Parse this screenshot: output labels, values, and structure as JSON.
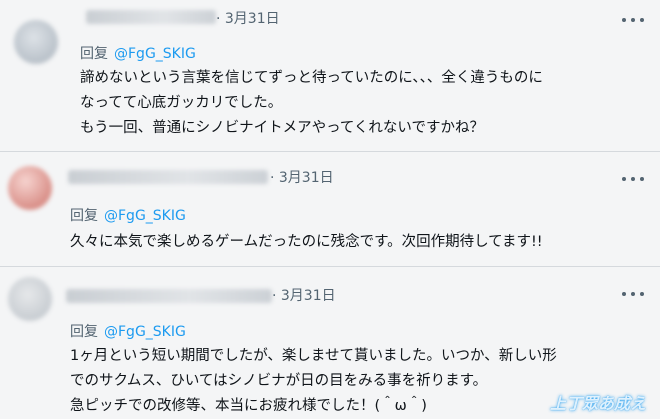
{
  "tweets": [
    {
      "date": "· 3月31日",
      "reply_label": "回复",
      "mention": "@FgG_SKIG",
      "body": "諦めないという言葉を信じてずっと待っていたのに、、、全く違うものに\nなってて心底ガッカリでした。\nもう一回、普通にシノビナイトメアやってくれないですかね？"
    },
    {
      "date": "· 3月31日",
      "reply_label": "回复",
      "mention": "@FgG_SKIG",
      "body": "久々に本気で楽しめるゲームだったのに残念です。次回作期待してます!!"
    },
    {
      "date": "· 3月31日",
      "reply_label": "回复",
      "mention": "@FgG_SKIG",
      "body": "1ヶ月という短い期間でしたが、楽しませて貰いました。いつか、新しい形\nでのサクムス、ひいてはシノビナが日の目をみる事を祈ります。\n急ピッチでの改修等、本当にお疲れ様でした！(＾ω＾)"
    }
  ],
  "icons": {
    "more": "more-horizontal-icon"
  },
  "colors": {
    "mention": "#1d9bf0",
    "secondary_text": "#536471",
    "background": "#f4f5f6"
  }
}
